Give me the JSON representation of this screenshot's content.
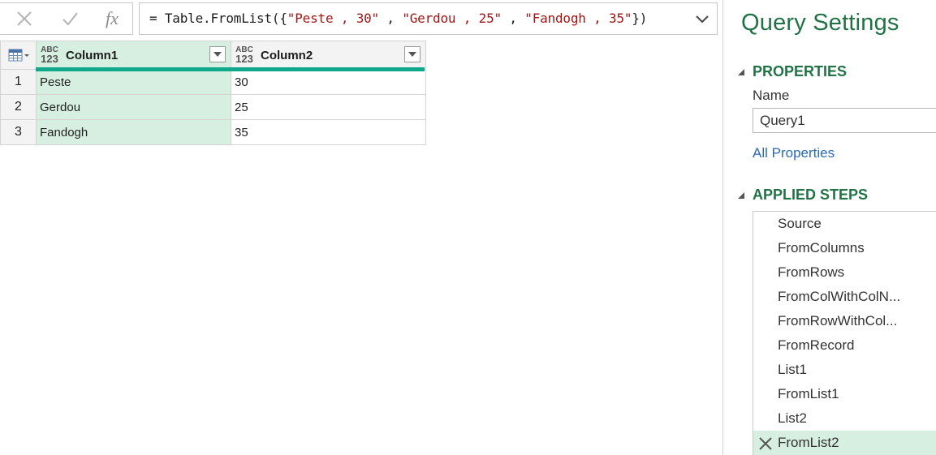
{
  "formula_bar": {
    "cancel_icon": "close-icon",
    "commit_icon": "check-icon",
    "fx_label": "fx",
    "formula_prefix": "= Table.FromList({",
    "formula_str1": "\"Peste , 30\"",
    "formula_sep1": " , ",
    "formula_str2": "\"Gerdou , 25\"",
    "formula_sep2": " , ",
    "formula_str3": "\"Fandogh , 35\"",
    "formula_suffix": "})",
    "expand_icon": "chevron-down-icon"
  },
  "grid": {
    "columns": [
      {
        "type_top": "ABC",
        "type_bottom": "123",
        "title": "Column1"
      },
      {
        "type_top": "ABC",
        "type_bottom": "123",
        "title": "Column2"
      }
    ],
    "rows": [
      {
        "num": "1",
        "c1": "Peste",
        "c2": "30"
      },
      {
        "num": "2",
        "c1": "Gerdou",
        "c2": "25"
      },
      {
        "num": "3",
        "c1": "Fandogh",
        "c2": "35"
      }
    ],
    "accent": "#0fa88b",
    "selected_column_color": "#d6efe1"
  },
  "query_settings": {
    "title": "Query Settings",
    "properties_header": "PROPERTIES",
    "name_label": "Name",
    "name_value": "Query1",
    "all_properties_link": "All Properties",
    "applied_steps_header": "APPLIED STEPS",
    "steps": [
      "Source",
      "FromColumns",
      "FromRows",
      "FromColWithColN...",
      "FromRowWithCol...",
      "FromRecord",
      "List1",
      "FromList1",
      "List2",
      "FromList2"
    ],
    "selected_step": "FromList2",
    "brand_color": "#217346",
    "link_color": "#2a6ab8"
  }
}
